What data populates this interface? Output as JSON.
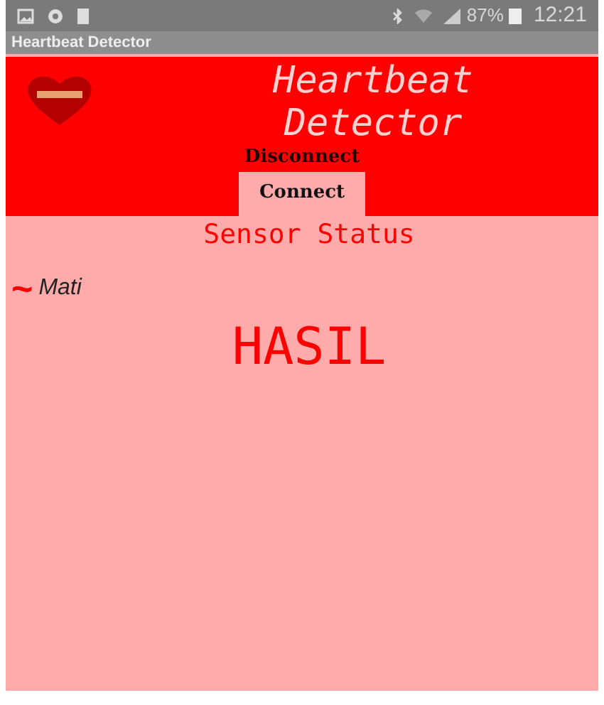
{
  "status_bar": {
    "battery": "87%",
    "time": "12:21"
  },
  "window": {
    "title": "Heartbeat Detector"
  },
  "header": {
    "title_lines": [
      "Heartbeat",
      "Detector"
    ]
  },
  "tabs": [
    {
      "label": "Disconnect",
      "selected": false
    },
    {
      "label": "Connect",
      "selected": true
    }
  ],
  "sensor_status": {
    "heading": "Sensor Status",
    "symbol": "~",
    "value": "Mati"
  },
  "result": "HASIL"
}
